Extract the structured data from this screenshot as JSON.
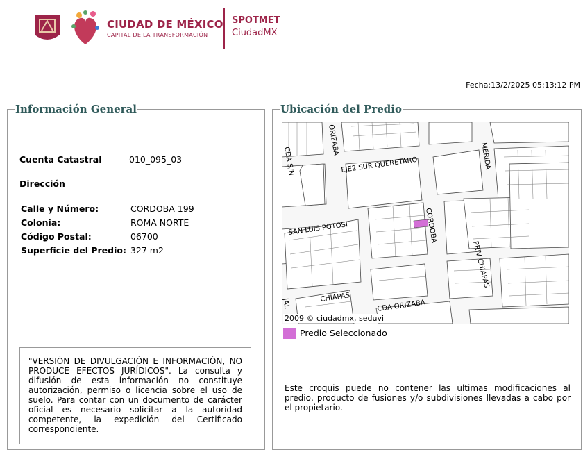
{
  "header": {
    "city_title": "CIUDAD DE MÉXICO",
    "city_subtitle": "CAPITAL DE LA TRANSFORMACIÓN",
    "app_title": "SPOTMET",
    "app_subtitle": "CiudadMX",
    "brand_color": "#9d2449"
  },
  "fecha": "Fecha:13/2/2025 05:13:12 PM",
  "info": {
    "legend": "Información General",
    "cuenta_label": "Cuenta Catastral",
    "cuenta_value": "010_095_03",
    "direccion_label": "Dirección",
    "rows": [
      {
        "k": "Calle y Número:",
        "v": "CORDOBA 199"
      },
      {
        "k": "Colonia:",
        "v": "ROMA NORTE"
      },
      {
        "k": "Código Postal:",
        "v": "06700"
      },
      {
        "k": "Superficie del Predio:",
        "v": "327 m2"
      }
    ],
    "disclaimer": "\"VERSIÓN DE DIVULGACIÓN E INFORMACIÓN, NO PRODUCE EFECTOS JURÍDICOS\". La consulta y difusión de esta información no constituye autorización, permiso o licencia sobre el uso de suelo. Para contar con un documento de carácter oficial es necesario solicitar a la autoridad competente, la expedición del Certificado correspondiente."
  },
  "map": {
    "legend": "Ubicación del Predio",
    "streets": [
      "ORIZABA",
      "CDA S/N",
      "EJE2 SUR QUERETARO",
      "MERIDA",
      "SAN LUIS POTOSI",
      "CORDOBA",
      "PRIV CHIAPAS",
      "CHIAPAS",
      "CDA ORIZABA",
      "JAL"
    ],
    "credit": "2009 © ciudadmx, seduvi",
    "legend_item": "Predio Seleccionado",
    "selected_color": "#d36fd6",
    "note": "Este croquis puede no contener las ultimas modificaciones al predio, producto de fusiones y/o subdivisiones llevadas a cabo por el propietario."
  }
}
